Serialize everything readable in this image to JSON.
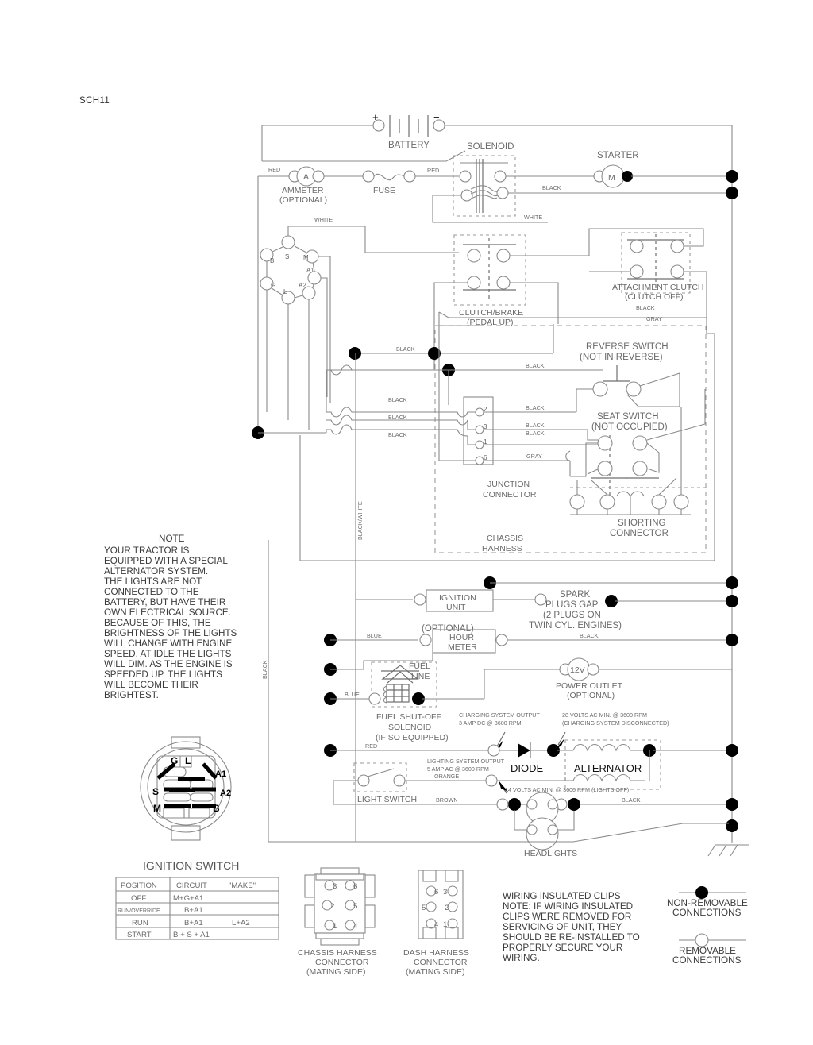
{
  "sheet": {
    "code": "SCH11"
  },
  "battery": {
    "label": "BATTERY",
    "plus": "+",
    "minus": "−"
  },
  "ammeter": {
    "label": "AMMETER",
    "sub": "(OPTIONAL)",
    "symbol": "A"
  },
  "fuse": {
    "label": "FUSE"
  },
  "solenoid": {
    "label": "SOLENOID"
  },
  "starter": {
    "label": "STARTER",
    "symbol": "M"
  },
  "ignition_switch_terminals": {
    "s": "S",
    "b": "B",
    "m": "M",
    "g": "G",
    "l": "L",
    "a1": "A1",
    "a2": "A2"
  },
  "clutch_brake": {
    "label": "CLUTCH/BRAKE",
    "sub": "(PEDAL UP)"
  },
  "attachment_clutch": {
    "label": "ATTACHMENT CLUTCH",
    "sub": "(CLUTCH OFF)"
  },
  "reverse_switch": {
    "label": "REVERSE SWITCH",
    "sub": "(NOT IN REVERSE)"
  },
  "seat_switch": {
    "label": "SEAT SWITCH",
    "sub": "(NOT OCCUPIED)"
  },
  "shorting_connector": {
    "line1": "SHORTING",
    "line2": "CONNECTOR"
  },
  "junction_connector": {
    "line1": "JUNCTION",
    "line2": "CONNECTOR",
    "pins": [
      "2",
      "3",
      "1",
      "6"
    ]
  },
  "chassis_harness": {
    "line1": "CHASSIS",
    "line2": "HARNESS"
  },
  "ignition_unit": {
    "line1": "IGNITION",
    "line2": "UNIT"
  },
  "spark_plugs": {
    "line1": "SPARK",
    "line2": "PLUGS GAP",
    "line3": "(2 PLUGS ON",
    "line4": "TWIN CYL. ENGINES)"
  },
  "hour_meter": {
    "optional": "(OPTIONAL)",
    "line1": "HOUR",
    "line2": "METER"
  },
  "fuel_solenoid": {
    "fuel": "FUEL",
    "line": "LINE",
    "line1": "FUEL SHUT-OFF",
    "line2": "SOLENOID",
    "line3": "(IF SO EQUIPPED)"
  },
  "power_outlet": {
    "symbol": "12V",
    "line1": "POWER OUTLET",
    "line2": "(OPTIONAL)"
  },
  "diode": {
    "label": "DIODE"
  },
  "alternator": {
    "label": "ALTERNATOR"
  },
  "light_switch": {
    "label": "LIGHT SWITCH"
  },
  "headlights": {
    "label": "HEADLIGHTS"
  },
  "annotations": {
    "charging_output": "CHARGING SYSTEM OUTPUT",
    "charging_output2": "3 AMP DC @ 3600 RPM",
    "ac_min": "28 VOLTS AC MIN. @ 3600 RPM",
    "ac_min2": "(CHARGING SYSTEM DISCONNECTED)",
    "lighting_output": "LIGHTING SYSTEM OUTPUT",
    "lighting_output2": "5 AMP AC @ 3600 RPM",
    "volts14": "14 VOLTS AC MIN. @ 3600 RPM (LIGHTS OFF)"
  },
  "wire_colors": {
    "red": "RED",
    "white": "WHITE",
    "black": "BLACK",
    "gray": "GRAY",
    "blue": "BLUE",
    "orange": "ORANGE",
    "brown": "BROWN",
    "black_white": "BLACK/WHITE"
  },
  "note": {
    "title": "NOTE",
    "lines": [
      "YOUR TRACTOR IS",
      "EQUIPPED WITH A SPECIAL",
      "ALTERNATOR SYSTEM.",
      "THE LIGHTS ARE NOT",
      "CONNECTED TO THE",
      "BATTERY, BUT HAVE THEIR",
      "OWN ELECTRICAL SOURCE.",
      "BECAUSE OF THIS, THE",
      "BRIGHTNESS OF THE LIGHTS",
      "WILL CHANGE WITH ENGINE",
      "SPEED.  AT IDLE THE LIGHTS",
      "WILL DIM.  AS THE ENGINE IS",
      "SPEEDED UP, THE LIGHTS",
      "WILL BECOME THEIR",
      "BRIGHTEST."
    ]
  },
  "ignition_switch": {
    "label": "IGNITION SWITCH"
  },
  "switch_table": {
    "headers": [
      "POSITION",
      "CIRCUIT",
      "\"MAKE\""
    ],
    "rows": [
      {
        "position": "OFF",
        "circuit": "M+G+A1",
        "make": ""
      },
      {
        "position": "RUN/OVERRIDE",
        "circuit": "B+A1",
        "make": ""
      },
      {
        "position": "RUN",
        "circuit": "B+A1",
        "make": "L+A2"
      },
      {
        "position": "START",
        "circuit": "B + S + A1",
        "make": ""
      }
    ]
  },
  "chassis_connector": {
    "line1": "CHASSIS HARNESS",
    "line2": "CONNECTOR",
    "line3": "(MATING SIDE)",
    "pins": [
      "3",
      "6",
      "2",
      "5",
      "1",
      "4"
    ]
  },
  "dash_connector": {
    "line1": "DASH HARNESS",
    "line2": "CONNECTOR",
    "line3": "(MATING SIDE)",
    "pins": [
      "6",
      "3",
      "5",
      "2",
      "4",
      "1"
    ]
  },
  "clips_note": {
    "lines": [
      "WIRING INSULATED CLIPS",
      "NOTE: IF WIRING INSULATED",
      "CLIPS WERE REMOVED FOR",
      "SERVICING OF UNIT, THEY",
      "SHOULD BE RE-INSTALLED TO",
      "PROPERLY SECURE YOUR",
      "WIRING."
    ]
  },
  "legend": {
    "non_removable_1": "NON-REMOVABLE",
    "non_removable_2": "CONNECTIONS",
    "removable_1": "REMOVABLE",
    "removable_2": "CONNECTIONS"
  }
}
